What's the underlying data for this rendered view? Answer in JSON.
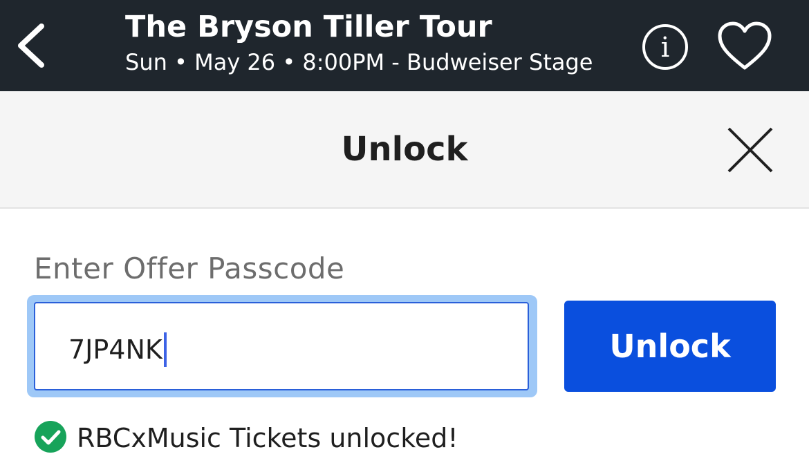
{
  "header": {
    "title": "The Bryson Tiller Tour",
    "subtitle": "Sun • May 26 • 8:00PM - Budweiser Stage",
    "back_icon": "chevron-left-icon",
    "info_icon": "info-icon",
    "favorite_icon": "heart-icon",
    "background_color": "#1f262d"
  },
  "modal": {
    "title": "Unlock",
    "close_icon": "close-icon"
  },
  "passcode": {
    "label": "Enter Offer Passcode",
    "value": "7JP4NK",
    "focus_ring_color": "#9ec8f7"
  },
  "unlock_button": {
    "label": "Unlock",
    "color": "#0a4fde"
  },
  "status": {
    "icon": "check-circle-icon",
    "message": "RBCxMusic Tickets unlocked!",
    "color": "#17a35a"
  }
}
